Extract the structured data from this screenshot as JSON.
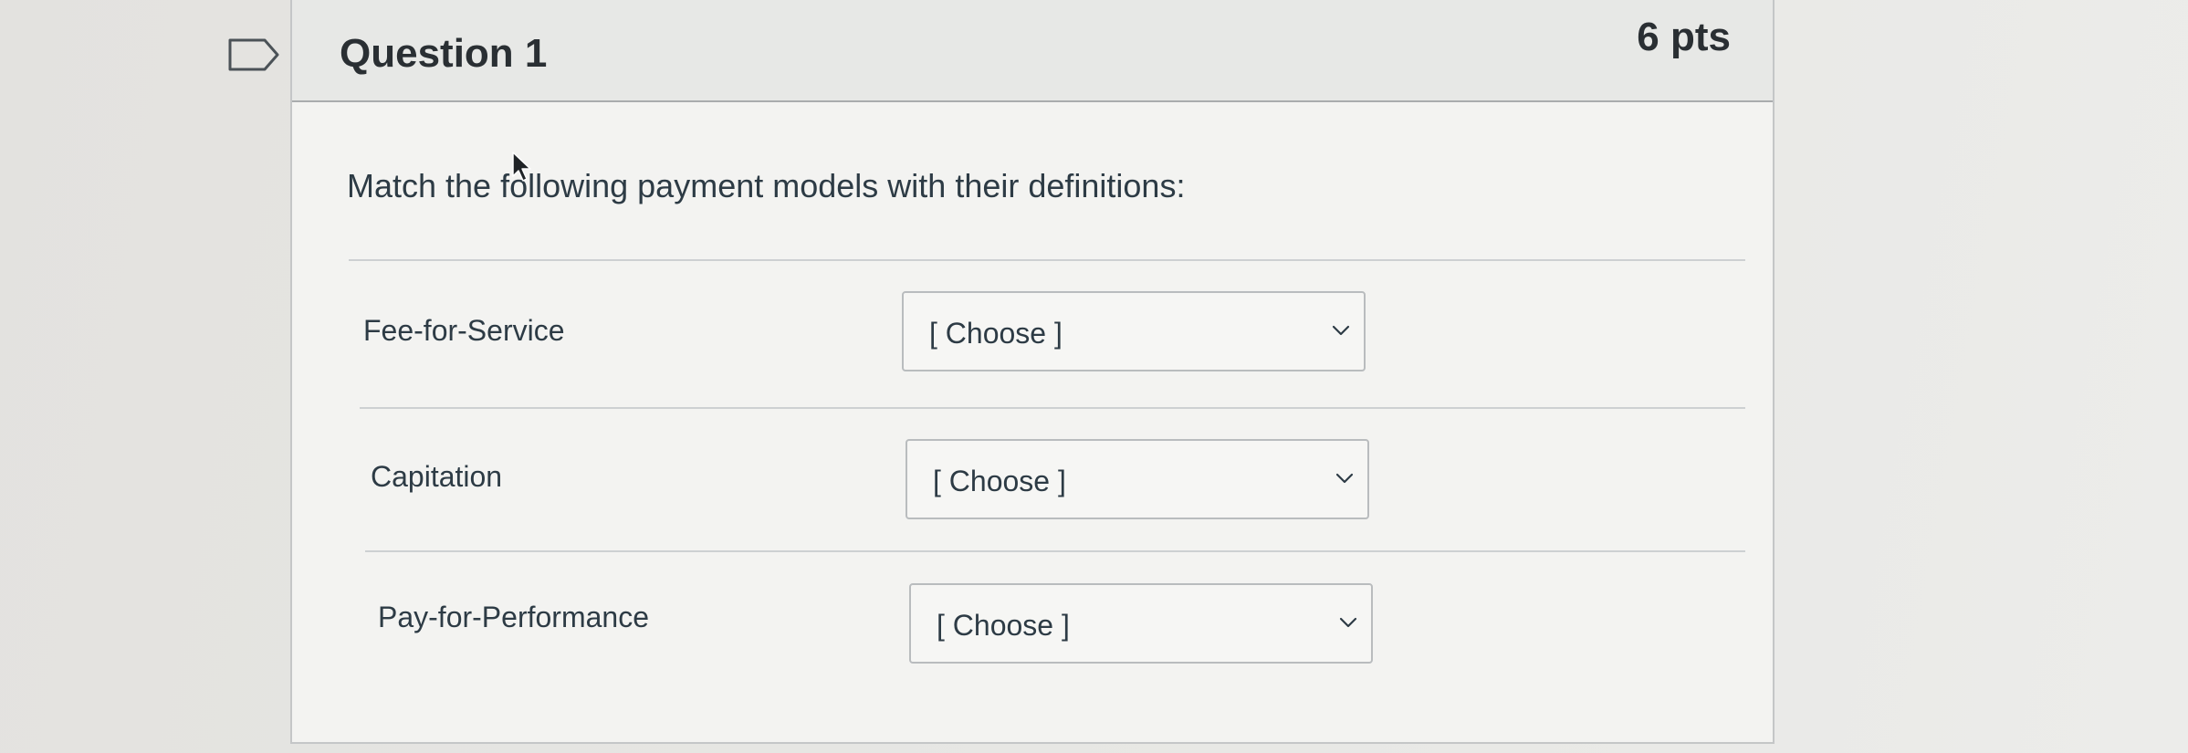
{
  "question": {
    "title": "Question 1",
    "points": "6 pts",
    "prompt": "Match the following payment models with their definitions:"
  },
  "matches": [
    {
      "label": "Fee-for-Service",
      "selected": "[ Choose ]"
    },
    {
      "label": "Capitation",
      "selected": "[ Choose ]"
    },
    {
      "label": "Pay-for-Performance",
      "selected": "[ Choose ]"
    }
  ],
  "icons": {
    "flag": "flag-outline-icon",
    "dropdown": "chevron-down-icon",
    "cursor": "mouse-pointer-icon"
  }
}
